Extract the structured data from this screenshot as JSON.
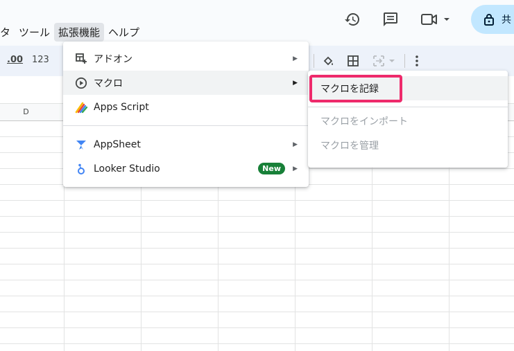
{
  "menubar": {
    "items": [
      {
        "label": "タ"
      },
      {
        "label": "ツール"
      },
      {
        "label": "拡張機能"
      },
      {
        "label": "ヘルプ"
      }
    ]
  },
  "header": {
    "history_icon": "history-icon",
    "comment_icon": "comment-icon",
    "meet_icon": "video-camera-icon",
    "share_label": "共"
  },
  "toolbar": {
    "decimal_label": ".00",
    "format_label": "123"
  },
  "grid": {
    "column_label": "D"
  },
  "extensions_menu": {
    "items": [
      {
        "label": "アドオン",
        "icon": "addon-icon",
        "has_submenu": true
      },
      {
        "label": "マクロ",
        "icon": "play-circle-icon",
        "has_submenu": true
      },
      {
        "label": "Apps Script",
        "icon": "apps-script-icon",
        "has_submenu": false
      },
      {
        "label": "AppSheet",
        "icon": "appsheet-icon",
        "has_submenu": true
      },
      {
        "label": "Looker Studio",
        "icon": "looker-studio-icon",
        "has_submenu": true,
        "badge": "New"
      }
    ]
  },
  "macro_submenu": {
    "items": [
      {
        "label": "マクロを記録",
        "enabled": true
      },
      {
        "label": "マクロをインポート",
        "enabled": false
      },
      {
        "label": "マクロを管理",
        "enabled": false
      }
    ]
  },
  "colors": {
    "accent_highlight": "#ee2a6b",
    "new_badge": "#188038",
    "share_button": "#c2e7ff",
    "toolbar_bg": "#edf2fa"
  }
}
